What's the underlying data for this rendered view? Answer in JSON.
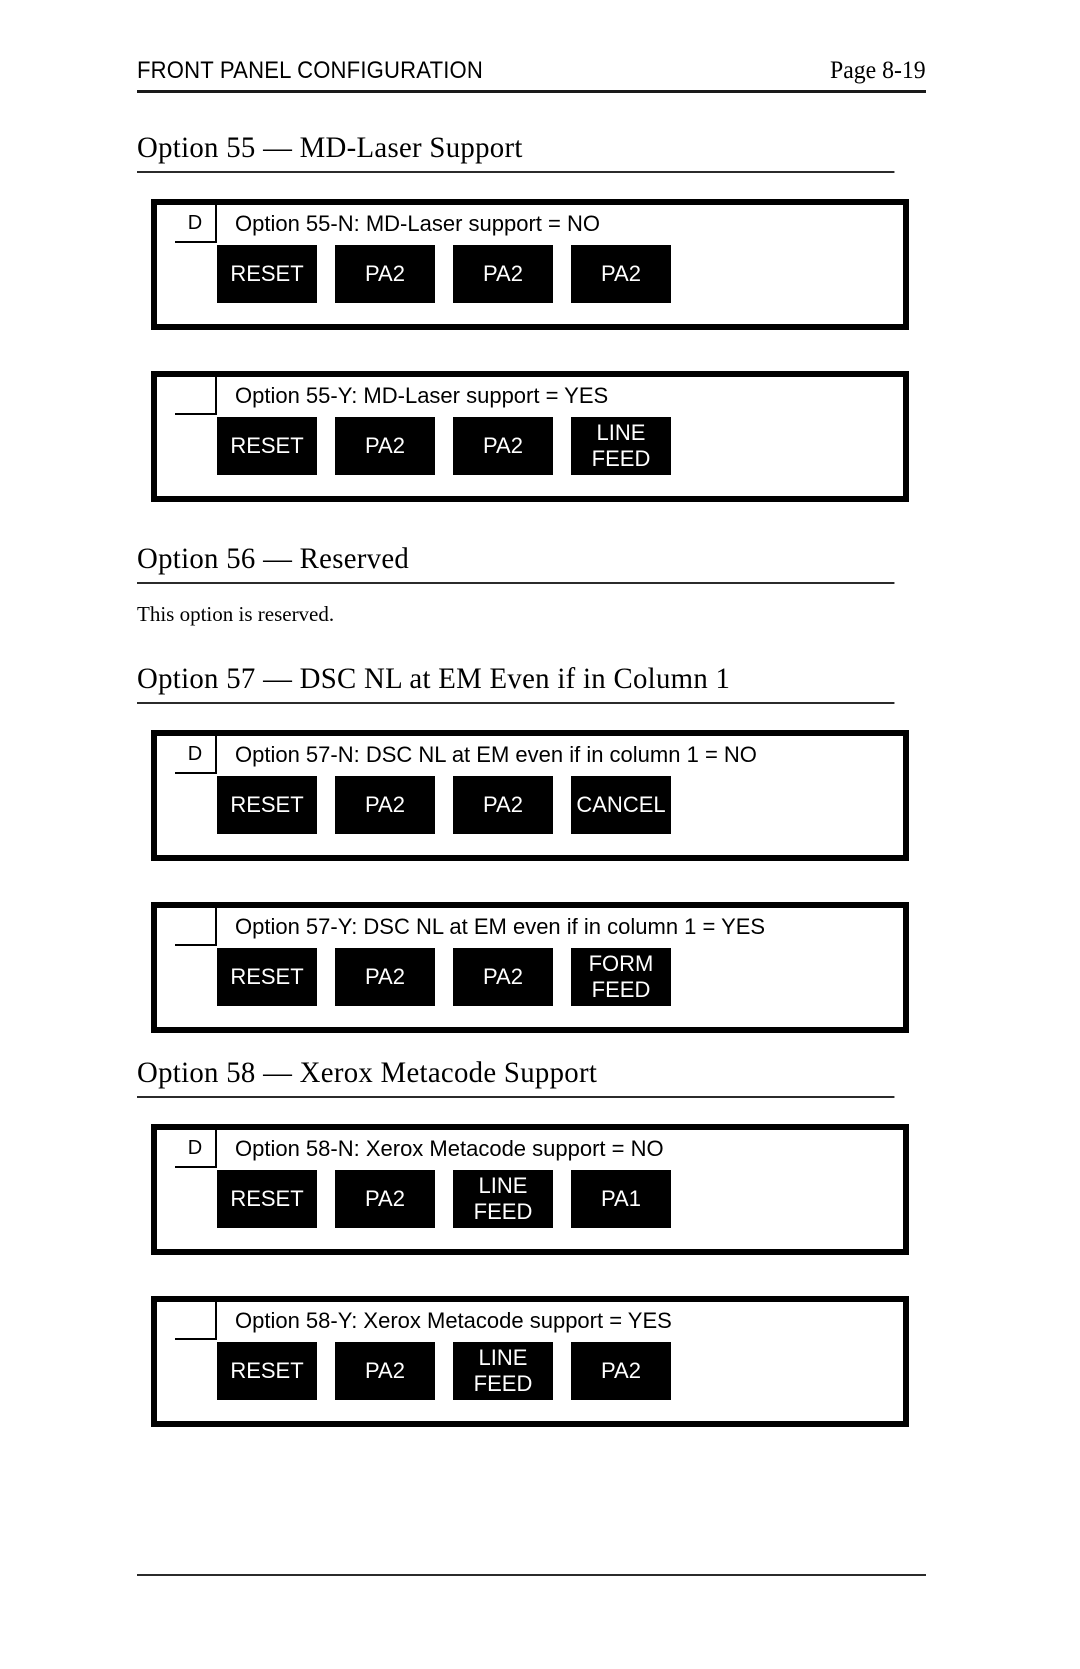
{
  "header": {
    "title": "FRONT PANEL CONFIGURATION",
    "page_label": "Page 8-19"
  },
  "sections": [
    {
      "heading": "Option 55 — MD-Laser Support",
      "panels": [
        {
          "default_marker": "D",
          "display_text": "Option 55-N: MD-Laser support = NO",
          "keys": [
            {
              "line1": "RESET",
              "line2": ""
            },
            {
              "line1": "PA2",
              "line2": ""
            },
            {
              "line1": "PA2",
              "line2": ""
            },
            {
              "line1": "PA2",
              "line2": ""
            }
          ]
        },
        {
          "default_marker": "",
          "display_text": "Option 55-Y: MD-Laser support = YES",
          "keys": [
            {
              "line1": "RESET",
              "line2": ""
            },
            {
              "line1": "PA2",
              "line2": ""
            },
            {
              "line1": "PA2",
              "line2": ""
            },
            {
              "line1": "LINE",
              "line2": "FEED"
            }
          ]
        }
      ]
    },
    {
      "heading": "Option 56 — Reserved",
      "body": "This option is reserved.",
      "panels": []
    },
    {
      "heading": "Option 57 — DSC NL at EM Even if in Column 1",
      "panels": [
        {
          "default_marker": "D",
          "display_text": "Option 57-N: DSC NL at EM even if in column 1 = NO",
          "keys": [
            {
              "line1": "RESET",
              "line2": ""
            },
            {
              "line1": "PA2",
              "line2": ""
            },
            {
              "line1": "PA2",
              "line2": ""
            },
            {
              "line1": "CANCEL",
              "line2": ""
            }
          ]
        },
        {
          "default_marker": "",
          "display_text": "Option 57-Y: DSC NL at EM even if in column 1 = YES",
          "keys": [
            {
              "line1": "RESET",
              "line2": ""
            },
            {
              "line1": "PA2",
              "line2": ""
            },
            {
              "line1": "PA2",
              "line2": ""
            },
            {
              "line1": "FORM",
              "line2": "FEED"
            }
          ]
        }
      ]
    },
    {
      "heading": "Option 58 — Xerox Metacode Support",
      "panels": [
        {
          "default_marker": "D",
          "display_text": "Option 58-N: Xerox Metacode support = NO",
          "keys": [
            {
              "line1": "RESET",
              "line2": ""
            },
            {
              "line1": "PA2",
              "line2": ""
            },
            {
              "line1": "LINE",
              "line2": "FEED"
            },
            {
              "line1": "PA1",
              "line2": ""
            }
          ]
        },
        {
          "default_marker": "",
          "display_text": "Option 58-Y: Xerox Metacode support = YES",
          "keys": [
            {
              "line1": "RESET",
              "line2": ""
            },
            {
              "line1": "PA2",
              "line2": ""
            },
            {
              "line1": "LINE",
              "line2": "FEED"
            },
            {
              "line1": "PA2",
              "line2": ""
            }
          ]
        }
      ]
    }
  ],
  "colors": {
    "ink": "#000000",
    "rule": "#2b2b2b",
    "paper": "#ffffff",
    "key_background": "#000000",
    "key_text": "#ffffff"
  }
}
